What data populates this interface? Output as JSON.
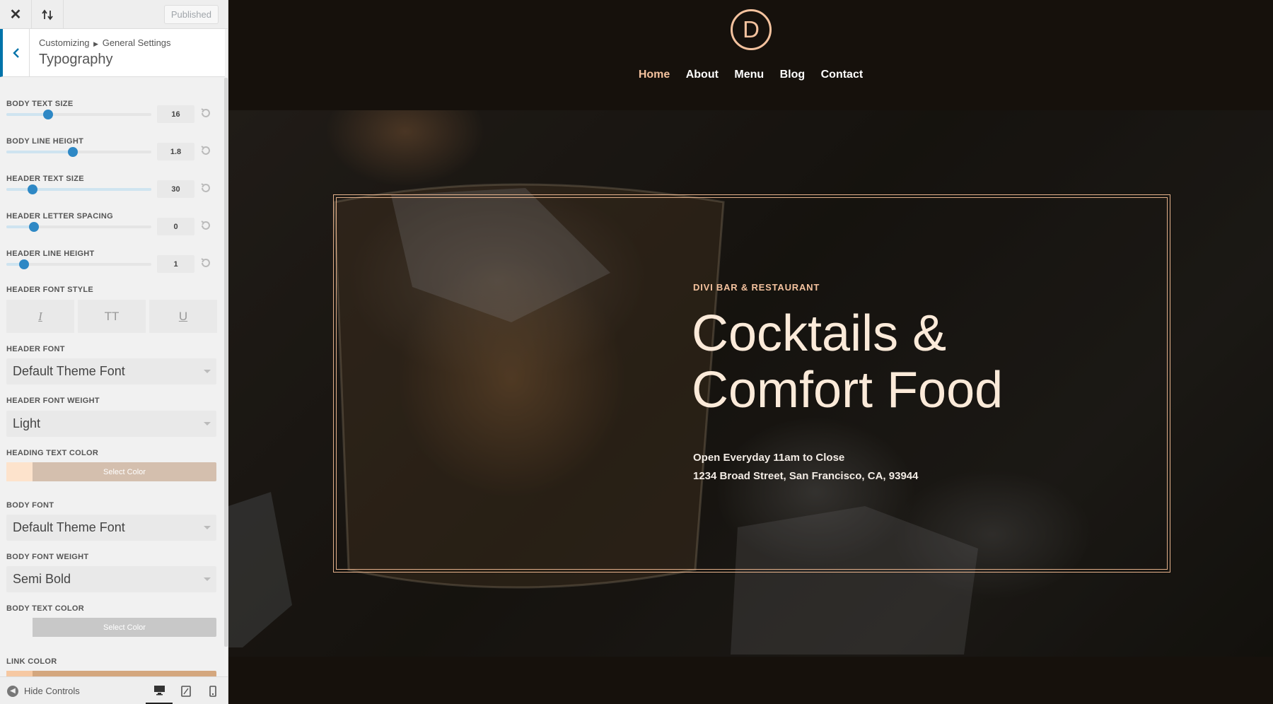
{
  "header": {
    "close_icon": "close-icon",
    "reorder_icon": "reorder-arrows-icon",
    "published_label": "Published"
  },
  "section": {
    "breadcrumb_root": "Customizing",
    "breadcrumb_parent": "General Settings",
    "title": "Typography"
  },
  "sliders": [
    {
      "label": "BODY TEXT SIZE",
      "value": "16",
      "level_percent": 29
    },
    {
      "label": "BODY LINE HEIGHT",
      "value": "1.8",
      "level_percent": 46
    },
    {
      "label": "HEADER TEXT SIZE",
      "value": "30",
      "level_percent": 18
    },
    {
      "label": "HEADER LETTER SPACING",
      "value": "0",
      "level_percent": 19
    },
    {
      "label": "HEADER LINE HEIGHT",
      "value": "1",
      "level_percent": 12
    }
  ],
  "font_style": {
    "label": "HEADER FONT STYLE",
    "italic": "I",
    "uppercase": "TT",
    "underline": "U"
  },
  "header_font": {
    "label": "HEADER FONT",
    "value": "Default Theme Font"
  },
  "header_font_weight": {
    "label": "HEADER FONT WEIGHT",
    "value": "Light"
  },
  "heading_text_color": {
    "label": "HEADING TEXT COLOR",
    "button": "Select Color",
    "swatch": "#fde3cc",
    "button_bg": "#d4bfae"
  },
  "body_font": {
    "label": "BODY FONT",
    "value": "Default Theme Font"
  },
  "body_font_weight": {
    "label": "BODY FONT WEIGHT",
    "value": "Semi Bold"
  },
  "body_text_color": {
    "label": "BODY TEXT COLOR",
    "button": "Select Color",
    "swatch": "#f1f1f1",
    "button_bg": "#c8c8c8"
  },
  "link_color": {
    "label": "LINK COLOR",
    "swatch": "#f6c8a2",
    "button_bg": "#d4a77e"
  },
  "footer": {
    "hide_controls": "Hide Controls",
    "devices": [
      "desktop-icon",
      "tablet-icon",
      "mobile-icon"
    ]
  },
  "site": {
    "logo_letter": "D",
    "nav": [
      "Home",
      "About",
      "Menu",
      "Blog",
      "Contact"
    ],
    "nav_active": "Home",
    "accent": "#f4c29e",
    "eyebrow": "DIVI BAR & RESTAURANT",
    "headline_line1": "Cocktails &",
    "headline_line2": "Comfort Food",
    "info_line1": "Open Everyday 11am to Close",
    "info_line2": "1234 Broad Street, San Francisco, CA, 93944"
  }
}
